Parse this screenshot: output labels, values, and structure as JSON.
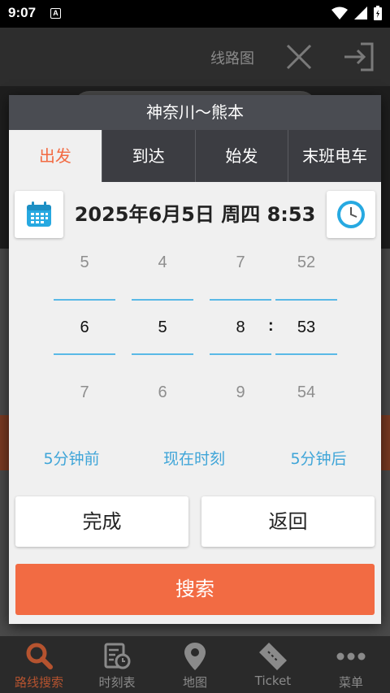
{
  "status_bar": {
    "time": "9:07",
    "badge": "A"
  },
  "header": {
    "map_label": "线路图"
  },
  "dialog": {
    "title": "神奈川〜熊本",
    "tabs": [
      "出发",
      "到达",
      "始发",
      "末班电车"
    ],
    "active_tab": "出发",
    "date_text": "2025年6月5日 周四 8:53",
    "picker": {
      "month": {
        "prev": "5",
        "current": "6",
        "next": "7"
      },
      "day": {
        "prev": "4",
        "current": "5",
        "next": "6"
      },
      "hour": {
        "prev": "7",
        "current": "8",
        "next": "9"
      },
      "minute": {
        "prev": "52",
        "current": "53",
        "next": "54"
      },
      "separator": ":"
    },
    "quick": {
      "before": "5分钟前",
      "now": "现在时刻",
      "after": "5分钟后"
    },
    "done_label": "完成",
    "back_label": "返回",
    "search_label": "搜索"
  },
  "bottom_nav": [
    {
      "label": "路线搜索",
      "icon": "search-icon",
      "active": true
    },
    {
      "label": "时刻表",
      "icon": "timetable-icon",
      "active": false
    },
    {
      "label": "地图",
      "icon": "map-pin-icon",
      "active": false
    },
    {
      "label": "Ticket",
      "icon": "ticket-icon",
      "active": false
    },
    {
      "label": "菜单",
      "icon": "more-icon",
      "active": false
    }
  ],
  "colors": {
    "accent": "#f26b43",
    "link": "#3fa5d8",
    "picker_line": "#5ab9e6",
    "title_bar": "#4a4c52"
  }
}
